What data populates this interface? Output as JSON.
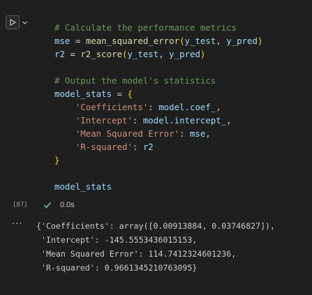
{
  "cell": {
    "exec_count": "[87]",
    "status_time": "0.0s",
    "code_lines": [
      [
        {
          "t": "# Calculate the performance metrics",
          "c": "comment"
        }
      ],
      [
        {
          "t": "mse",
          "c": "var"
        },
        {
          "t": " = ",
          "c": "op"
        },
        {
          "t": "mean_squared_error",
          "c": "fn"
        },
        {
          "t": "(",
          "c": "paren"
        },
        {
          "t": "y_test",
          "c": "var"
        },
        {
          "t": ", ",
          "c": "plain"
        },
        {
          "t": "y_pred",
          "c": "var"
        },
        {
          "t": ")",
          "c": "paren"
        }
      ],
      [
        {
          "t": "r2",
          "c": "var"
        },
        {
          "t": " = ",
          "c": "op"
        },
        {
          "t": "r2_score",
          "c": "fn"
        },
        {
          "t": "(",
          "c": "paren"
        },
        {
          "t": "y_test",
          "c": "var"
        },
        {
          "t": ", ",
          "c": "plain"
        },
        {
          "t": "y_pred",
          "c": "var"
        },
        {
          "t": ")",
          "c": "paren"
        }
      ],
      [],
      [
        {
          "t": "# Output the model's statistics",
          "c": "comment"
        }
      ],
      [
        {
          "t": "model_stats",
          "c": "var"
        },
        {
          "t": " = ",
          "c": "op"
        },
        {
          "t": "{",
          "c": "paren"
        }
      ],
      [
        {
          "t": "    ",
          "c": "plain"
        },
        {
          "t": "'Coefficients'",
          "c": "str"
        },
        {
          "t": ": ",
          "c": "plain"
        },
        {
          "t": "model",
          "c": "var"
        },
        {
          "t": ".",
          "c": "plain"
        },
        {
          "t": "coef_",
          "c": "var"
        },
        {
          "t": ",",
          "c": "plain"
        }
      ],
      [
        {
          "t": "    ",
          "c": "plain"
        },
        {
          "t": "'Intercept'",
          "c": "str"
        },
        {
          "t": ": ",
          "c": "plain"
        },
        {
          "t": "model",
          "c": "var"
        },
        {
          "t": ".",
          "c": "plain"
        },
        {
          "t": "intercept_",
          "c": "var"
        },
        {
          "t": ",",
          "c": "plain"
        }
      ],
      [
        {
          "t": "    ",
          "c": "plain"
        },
        {
          "t": "'Mean Squared Error'",
          "c": "str"
        },
        {
          "t": ": ",
          "c": "plain"
        },
        {
          "t": "mse",
          "c": "var"
        },
        {
          "t": ",",
          "c": "plain"
        }
      ],
      [
        {
          "t": "    ",
          "c": "plain"
        },
        {
          "t": "'R-squared'",
          "c": "str"
        },
        {
          "t": ": ",
          "c": "plain"
        },
        {
          "t": "r2",
          "c": "var"
        }
      ],
      [
        {
          "t": "}",
          "c": "paren"
        }
      ],
      [],
      [
        {
          "t": "model_stats",
          "c": "var"
        }
      ]
    ]
  },
  "output": {
    "more_label": "···",
    "lines": [
      "{'Coefficients': array([0.00913884, 0.03746827]),",
      " 'Intercept': -145.5553436015153,",
      " 'Mean Squared Error': 114.7412324601236,",
      " 'R-squared': 0.9661345210763095}"
    ]
  }
}
